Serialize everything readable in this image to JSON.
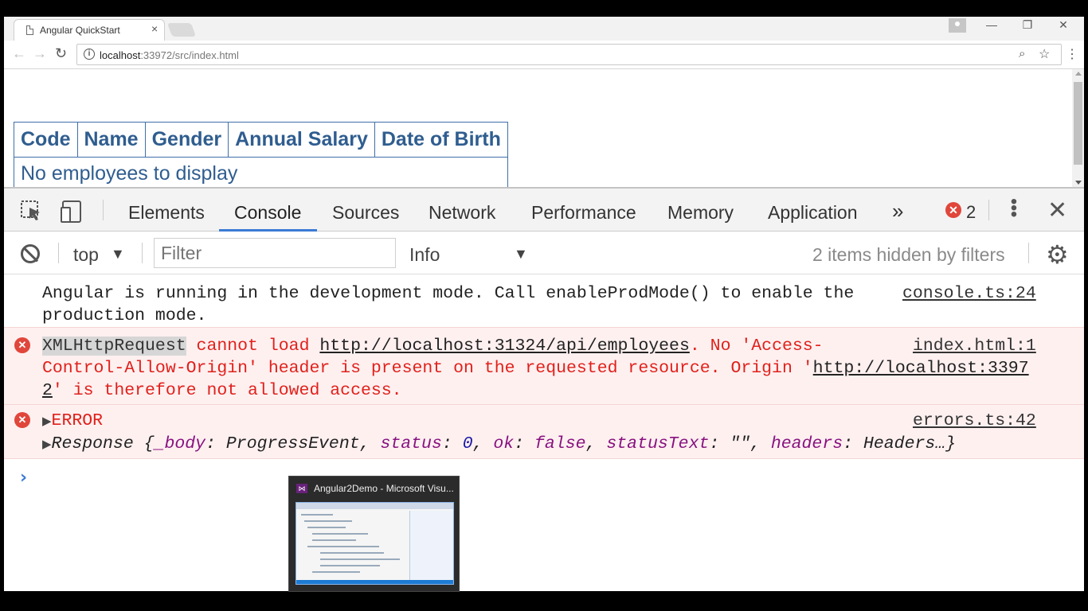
{
  "browser": {
    "tab_title": "Angular QuickStart",
    "tab_close": "×",
    "url_host": "localhost",
    "url_rest": ":33972/src/index.html",
    "window_minimize": "—",
    "window_restore": "❐",
    "window_close": "✕"
  },
  "page": {
    "table": {
      "headers": [
        "Code",
        "Name",
        "Gender",
        "Annual Salary",
        "Date of Birth"
      ],
      "empty_message": "No employees to display"
    }
  },
  "devtools": {
    "tabs": [
      "Elements",
      "Console",
      "Sources",
      "Network",
      "Performance",
      "Memory",
      "Application"
    ],
    "active_tab": "Console",
    "more_tabs": "»",
    "error_count": "2",
    "close": "✕",
    "filter_bar": {
      "context": "top",
      "filter_placeholder": "Filter",
      "level": "Info",
      "hidden_info": "2 items hidden by filters"
    },
    "console": {
      "log_line1": "Angular is running in the development mode. Call enableProdMode() to enable the",
      "log_line2": "production mode.",
      "log_source": "console.ts:24",
      "error1_xhr": "XMLHttpRequest",
      "error1_part1": " cannot load ",
      "error1_url1": "http://localhost:31324/api/employees",
      "error1_part2": ". No 'Access-",
      "error1_line2a": "Control-Allow-Origin' header is present on the requested resource. Origin '",
      "error1_url2a": "http://localhost:3397",
      "error1_url2b": "2",
      "error1_line3": "' is therefore not allowed access.",
      "error1_source": "index.html:1",
      "error2_label": "ERROR",
      "error2_source": "errors.ts:42",
      "response": {
        "name": "Response",
        "open": " {",
        "k1": "_body",
        "v1": "ProgressEvent",
        "k2": "status",
        "v2": "0",
        "k3": "ok",
        "v3": "false",
        "k4": "statusText",
        "v4": "\"\"",
        "k5": "headers",
        "v5": "Headers…}"
      },
      "prompt": "›"
    }
  },
  "taskbar_thumbnail": {
    "title": "Angular2Demo - Microsoft Visu..."
  }
}
